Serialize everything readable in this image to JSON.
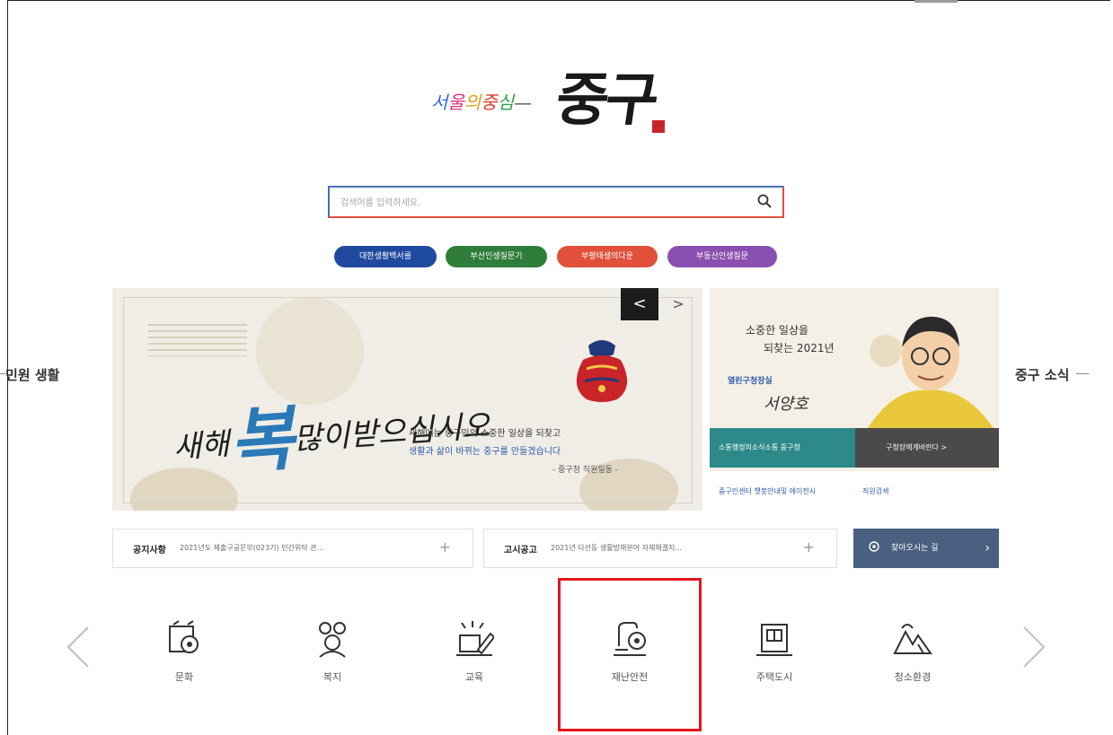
{
  "logo": {
    "subtitle": [
      "서",
      "울",
      "의",
      "중",
      "심",
      "—"
    ],
    "title": "중구"
  },
  "search": {
    "placeholder": "검색어를 입력하세요."
  },
  "quick_links": [
    "대한생활백서를",
    "부산인생질문기",
    "부평태생의다운",
    "부동산인생질문"
  ],
  "side": {
    "left": "민원 생활",
    "right": "중구 소식"
  },
  "banner": {
    "calligraphy_pre": "새해",
    "calligraphy_big": "복",
    "calligraphy_post": "많이받으십시오",
    "line1": "새해에는 중구민의 소중한 일상을 되찾고",
    "line2": "생활과 삶이 바뀌는 중구를 만들겠습니다",
    "line3": "- 중구청 직원일동 -",
    "prev": "<",
    "next": ">"
  },
  "mayor": {
    "message_1": "소중한 일상을",
    "message_2": "되찾는 2021년",
    "role": "열린구청장실",
    "name": "서양호",
    "strip_left": "소통행정의소식소통 중구청",
    "strip_right": "구청장에게바란다 >",
    "link_1": "중구인센터 챗봇안내및 에이전시",
    "link_2": "직원검색"
  },
  "notices": [
    {
      "title": "공지사항",
      "content": "2021년도 제출구공문부(023기) 민간위탁 관..."
    },
    {
      "title": "고시공고",
      "content": "2021년 다선동 생활방재분야 자체해결지..."
    }
  ],
  "directions": "찾아오시는 길",
  "categories": [
    {
      "label": "문화",
      "icon": "culture-icon"
    },
    {
      "label": "복지",
      "icon": "welfare-icon"
    },
    {
      "label": "교육",
      "icon": "education-icon"
    },
    {
      "label": "재난안전",
      "icon": "disaster-safety-icon"
    },
    {
      "label": "주택도시",
      "icon": "housing-icon"
    },
    {
      "label": "청소환경",
      "icon": "environment-icon"
    }
  ],
  "colors": {
    "highlight": "#e5141a",
    "primary_blue": "#1f4aa0",
    "teal": "#2e8a8a"
  }
}
